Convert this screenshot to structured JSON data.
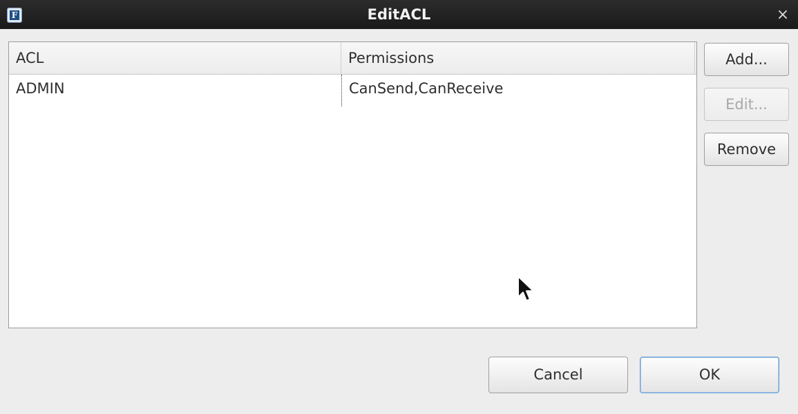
{
  "window": {
    "title": "EditACL",
    "app_icon_letter": "F",
    "close_glyph": "×"
  },
  "table": {
    "columns": [
      "ACL",
      "Permissions"
    ],
    "rows": [
      {
        "acl": "ADMIN",
        "permissions": "CanSend,CanReceive"
      }
    ]
  },
  "side_buttons": {
    "add_label": "Add...",
    "edit_label": "Edit...",
    "remove_label": "Remove",
    "edit_enabled": false
  },
  "footer": {
    "cancel_label": "Cancel",
    "ok_label": "OK"
  },
  "icons": {
    "app": "app-f-icon",
    "close": "close-icon",
    "cursor": "mouse-pointer-icon"
  },
  "colors": {
    "titlebar": "#1f1f1f",
    "background": "#ededed",
    "ok_border": "#6a9fd4"
  }
}
